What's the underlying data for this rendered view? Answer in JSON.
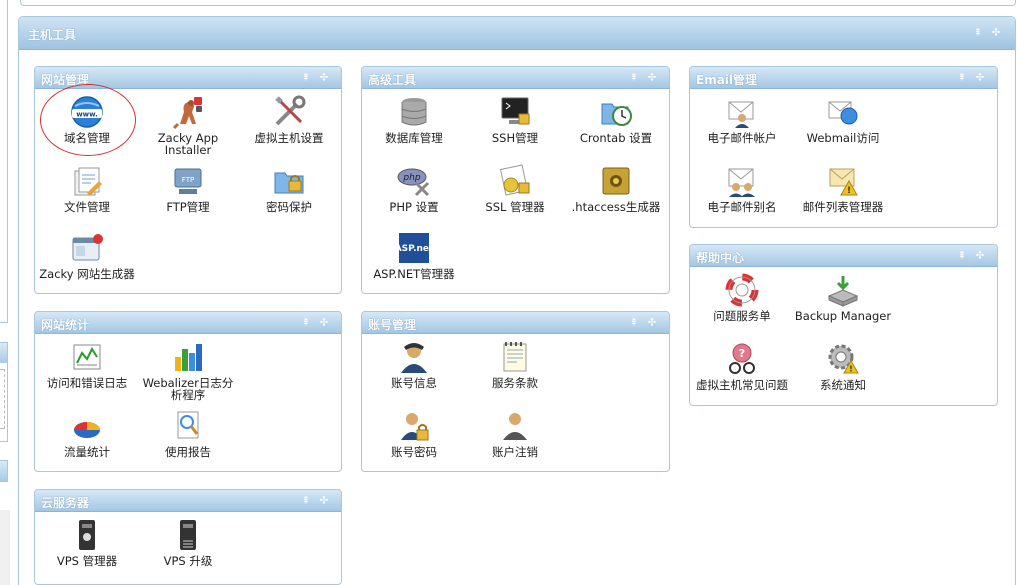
{
  "outer": {
    "title": "主机工具"
  },
  "controls": {
    "collapse": "⇞",
    "move": "✣"
  },
  "panels": {
    "site_mgmt": {
      "title": "网站管理",
      "items": [
        {
          "label": "域名管理",
          "icon": "www-globe-icon"
        },
        {
          "label": "Zacky App Installer",
          "icon": "kangaroo-icon"
        },
        {
          "label": "虚拟主机设置",
          "icon": "tools-icon"
        },
        {
          "label": "文件管理",
          "icon": "file-manager-icon"
        },
        {
          "label": "FTP管理",
          "icon": "ftp-icon"
        },
        {
          "label": "密码保护",
          "icon": "folder-lock-icon"
        },
        {
          "label": "Zacky 网站生成器",
          "icon": "site-builder-icon"
        }
      ]
    },
    "advanced": {
      "title": "高级工具",
      "items": [
        {
          "label": "数据库管理",
          "icon": "database-icon"
        },
        {
          "label": "SSH管理",
          "icon": "terminal-icon"
        },
        {
          "label": "Crontab 设置",
          "icon": "clock-icon"
        },
        {
          "label": "PHP 设置",
          "icon": "php-icon"
        },
        {
          "label": "SSL 管理器",
          "icon": "ssl-cert-icon"
        },
        {
          "label": ".htaccess生成器",
          "icon": "safe-icon"
        },
        {
          "label": "ASP.NET管理器",
          "icon": "aspnet-icon",
          "badge": "ASP.net"
        }
      ]
    },
    "email": {
      "title": "Email管理",
      "items": [
        {
          "label": "电子邮件帐户",
          "icon": "mail-user-icon"
        },
        {
          "label": "Webmail访问",
          "icon": "webmail-icon"
        },
        {
          "label": "电子邮件别名",
          "icon": "mail-alias-icon"
        },
        {
          "label": "邮件列表管理器",
          "icon": "mailing-list-icon"
        }
      ]
    },
    "help": {
      "title": "帮助中心",
      "items": [
        {
          "label": "问题服务单",
          "icon": "lifebuoy-icon"
        },
        {
          "label": "Backup Manager",
          "icon": "backup-icon"
        },
        {
          "label": "虚拟主机常见问题",
          "icon": "faq-icon"
        },
        {
          "label": "系统通知",
          "icon": "notice-gear-icon"
        }
      ]
    },
    "stats": {
      "title": "网站统计",
      "items": [
        {
          "label": "访问和错误日志",
          "icon": "logs-chart-icon"
        },
        {
          "label": "Webalizer日志分析程序",
          "icon": "bar-chart-icon"
        },
        {
          "label": "流量统计",
          "icon": "pie-chart-icon"
        },
        {
          "label": "使用报告",
          "icon": "report-icon"
        }
      ]
    },
    "account": {
      "title": "账号管理",
      "items": [
        {
          "label": "账号信息",
          "icon": "user-info-icon"
        },
        {
          "label": "服务条款",
          "icon": "notepad-icon"
        },
        {
          "label": "账号密码",
          "icon": "user-lock-icon"
        },
        {
          "label": "账户注销",
          "icon": "user-logout-icon"
        }
      ]
    },
    "cloud": {
      "title": "云服务器",
      "items": [
        {
          "label": "VPS 管理器",
          "icon": "vps-server-icon"
        },
        {
          "label": "VPS 升级",
          "icon": "vps-upgrade-icon"
        }
      ]
    }
  }
}
